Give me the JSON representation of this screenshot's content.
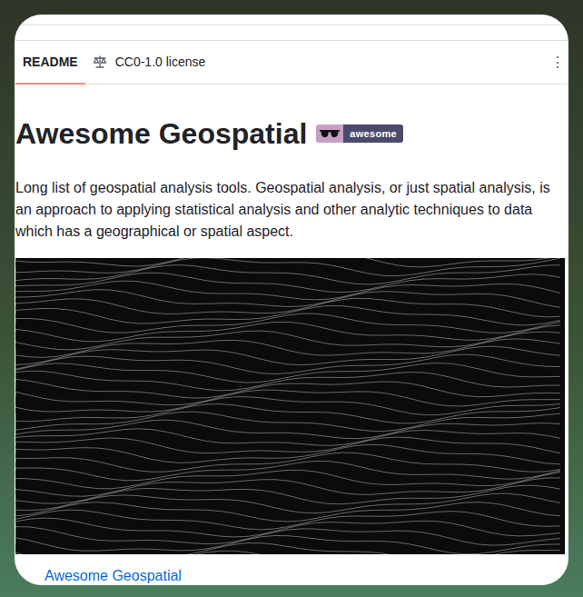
{
  "tabs": [
    {
      "label": "README",
      "selected": true
    },
    {
      "label": "CC0-1.0 license",
      "selected": false
    }
  ],
  "menu_icon": "⋮",
  "heading": "Awesome Geospatial",
  "badge": "awesome",
  "description": "Long list of geospatial analysis tools. Geospatial analysis, or just spatial analysis, is an approach to applying statistical analysis and other analytic techniques to data which has a geographical or spatial aspect.",
  "toc": [
    {
      "label": "Awesome Geospatial"
    }
  ]
}
